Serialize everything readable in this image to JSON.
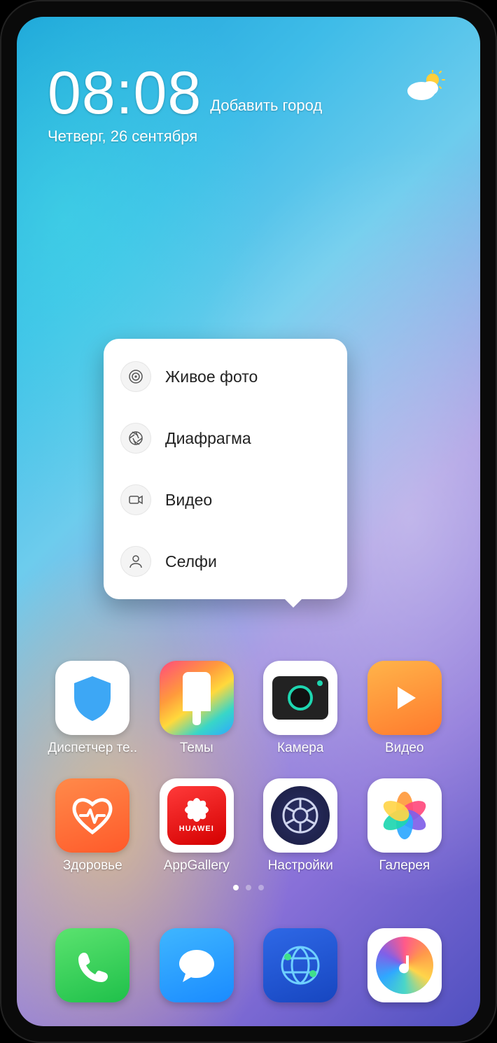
{
  "clock": {
    "time": "08:08",
    "add_city": "Добавить город",
    "date": "Четверг, 26 сентября"
  },
  "weather": {
    "icon": "partly-cloudy"
  },
  "popup": {
    "items": [
      {
        "icon": "live-photo",
        "label": "Живое фото"
      },
      {
        "icon": "aperture",
        "label": "Диафрагма"
      },
      {
        "icon": "video",
        "label": "Видео"
      },
      {
        "icon": "selfie",
        "label": "Селфи"
      }
    ]
  },
  "grid": [
    {
      "id": "phone-manager",
      "label": "Диспетчер те.."
    },
    {
      "id": "themes",
      "label": "Темы"
    },
    {
      "id": "camera",
      "label": "Камера"
    },
    {
      "id": "video",
      "label": "Видео"
    },
    {
      "id": "health",
      "label": "Здоровье"
    },
    {
      "id": "appgallery",
      "label": "AppGallery"
    },
    {
      "id": "settings",
      "label": "Настройки"
    },
    {
      "id": "gallery",
      "label": "Галерея"
    }
  ],
  "dock": [
    {
      "id": "phone"
    },
    {
      "id": "messages"
    },
    {
      "id": "browser"
    },
    {
      "id": "music"
    }
  ],
  "pages": {
    "count": 3,
    "active": 0
  },
  "appgallery_text": "HUAWEI"
}
